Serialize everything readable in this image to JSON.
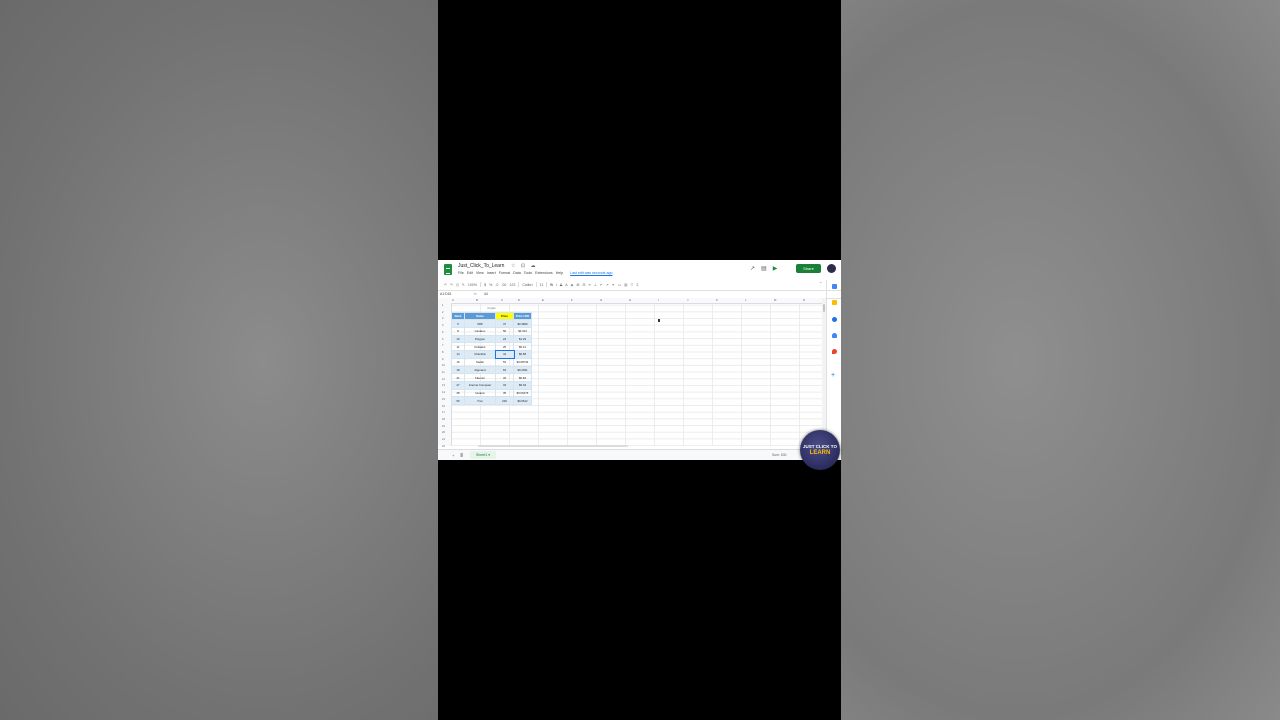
{
  "app": {
    "doc_title": "Just_Click_To_Learn",
    "title_icons": "☆ ⊡ ☁",
    "menu": [
      "File",
      "Edit",
      "View",
      "Insert",
      "Format",
      "Data",
      "Tools",
      "Extensions",
      "Help"
    ],
    "last_edit": "Last edit was seconds ago",
    "share_label": "Share",
    "accent_color": "#188038"
  },
  "toolbar": {
    "zoom": "100%",
    "currency": "$",
    "percent": "%",
    "dec_less": ".0",
    "dec_more": ".00",
    "number_format": "123",
    "font": "Calibri",
    "font_size": "11"
  },
  "formula_bar": {
    "name_box": "A1:D15",
    "fx": "fx",
    "value": "44"
  },
  "columns": [
    "A",
    "B",
    "C",
    "D",
    "E",
    "F",
    "G",
    "H",
    "I",
    "J",
    "K",
    "L",
    "M",
    "N"
  ],
  "rows": [
    "1",
    "2",
    "3",
    "4",
    "5",
    "6",
    "7",
    "8",
    "9",
    "10",
    "11",
    "12",
    "13",
    "14",
    "15",
    "16",
    "17",
    "18",
    "19",
    "20",
    "21",
    "22"
  ],
  "table": {
    "title": "Crypto",
    "headers": [
      "Rank",
      "Name",
      "Price",
      "Price USD"
    ],
    "rows": [
      [
        "5",
        "XRP",
        "47",
        "$0.3849"
      ],
      [
        "8",
        "Cardano",
        "56",
        "$0.313"
      ],
      [
        "10",
        "Polygon",
        "24",
        "$1.29"
      ],
      [
        "11",
        "Polkadot",
        "25",
        "$5.41"
      ],
      [
        "14",
        "Chainlink",
        "44",
        "$6.58"
      ],
      [
        "16",
        "Stellar",
        "53",
        "$0.08734"
      ],
      [
        "18",
        "Algorand",
        "63",
        "$0.2031"
      ],
      [
        "21",
        "Filecoin",
        "32",
        "$5.84"
      ],
      [
        "27",
        "Internet Computer",
        "34",
        "$5.04"
      ],
      [
        "38",
        "Hedera",
        "35",
        "$0.06476"
      ],
      [
        "50",
        "Tron",
        "200",
        "$0.0612"
      ]
    ],
    "header_color": "#5b9bd5",
    "highlight_color": "#ffff00",
    "band_color": "#ddebf7"
  },
  "sheet_tabs": {
    "tabs": [
      "Sheet1"
    ],
    "sum_label": "Sum: 630"
  },
  "badge": {
    "line1": "JUST CLICK TO",
    "line2": "LEARN"
  }
}
